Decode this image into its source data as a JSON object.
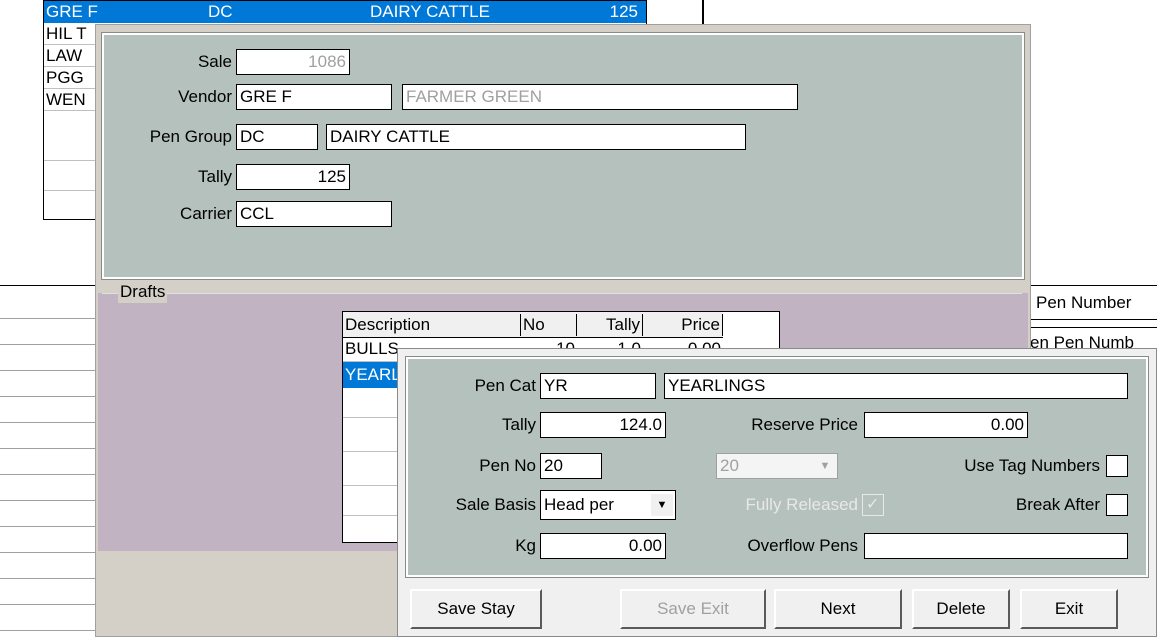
{
  "bg_list": {
    "rows": [
      {
        "code": "GRE F",
        "group": "DC",
        "desc": "DAIRY CATTLE",
        "tally": "125"
      },
      {
        "code": "HIL T"
      },
      {
        "code": "LAW"
      },
      {
        "code": "PGG"
      },
      {
        "code": "WEN"
      }
    ]
  },
  "right_grid": {
    "header1": "Pen Number",
    "header2": "en Pen Numb"
  },
  "sale_form": {
    "sale_label": "Sale",
    "sale_value": "1086",
    "vendor_label": "Vendor",
    "vendor_code": "GRE F",
    "vendor_name": "FARMER GREEN",
    "pen_group_label": "Pen Group",
    "pen_group_code": "DC",
    "pen_group_name": "DAIRY CATTLE",
    "tally_label": "Tally",
    "tally_value": "125",
    "carrier_label": "Carrier",
    "carrier_value": "CCL"
  },
  "drafts": {
    "title": "Drafts",
    "columns": [
      "Description",
      "No",
      "Tally",
      "Price"
    ],
    "rows": [
      {
        "description": "BULLS",
        "no": "10",
        "tally": "1.0",
        "price": "0.00"
      },
      {
        "description": "YEARLINGS"
      }
    ]
  },
  "draft_detail": {
    "pen_cat_label": "Pen Cat",
    "pen_cat_code": "YR",
    "pen_cat_name": "YEARLINGS",
    "tally_label": "Tally",
    "tally_value": "124.0",
    "reserve_label": "Reserve Price",
    "reserve_value": "0.00",
    "pen_no_label": "Pen No",
    "pen_no_value": "20",
    "pen_no_select": "20",
    "use_tag_label": "Use Tag Numbers",
    "sale_basis_label": "Sale Basis",
    "sale_basis_value": "Head per",
    "fully_released_label": "Fully Released",
    "break_after_label": "Break After",
    "kg_label": "Kg",
    "kg_value": "0.00",
    "overflow_label": "Overflow Pens",
    "overflow_value": ""
  },
  "buttons": {
    "save_stay": "Save  Stay",
    "save_exit": "Save  Exit",
    "next": "Next",
    "delete": "Delete",
    "exit": "Exit"
  },
  "colors": {
    "sale_panel": "#b4c1bc",
    "drafts_panel": "#c1b3c2",
    "selection": "#0078d7",
    "button_face": "#f0f0f0"
  }
}
